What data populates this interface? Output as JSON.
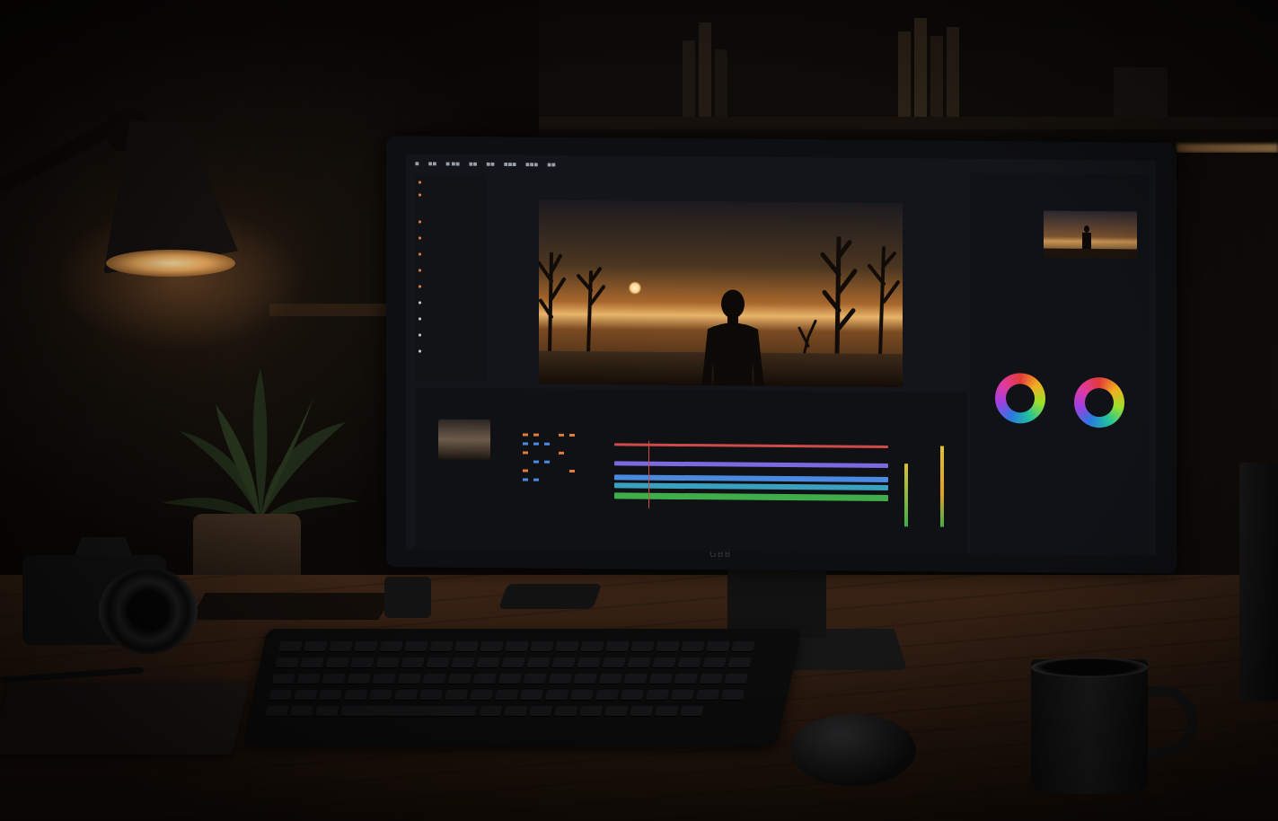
{
  "monitor": {
    "brand": "GBB"
  },
  "editor": {
    "menu": [
      "■",
      "■■",
      "■ ■■",
      "■■",
      "■■",
      "■■■",
      "■■■",
      "■■"
    ],
    "viewer_controls": "◂ ▮▮ ▸",
    "color_wheels": [
      "wheel-1",
      "wheel-2"
    ],
    "accent": "#e07b3a",
    "track_colors": [
      "#d04a4a",
      "#7a6ae0",
      "#4a8ae0",
      "#3aa0c0",
      "#3fae4a"
    ]
  },
  "icons": [
    "lamp",
    "plant",
    "camera",
    "keyboard",
    "mouse",
    "mug",
    "notebook",
    "speaker"
  ]
}
